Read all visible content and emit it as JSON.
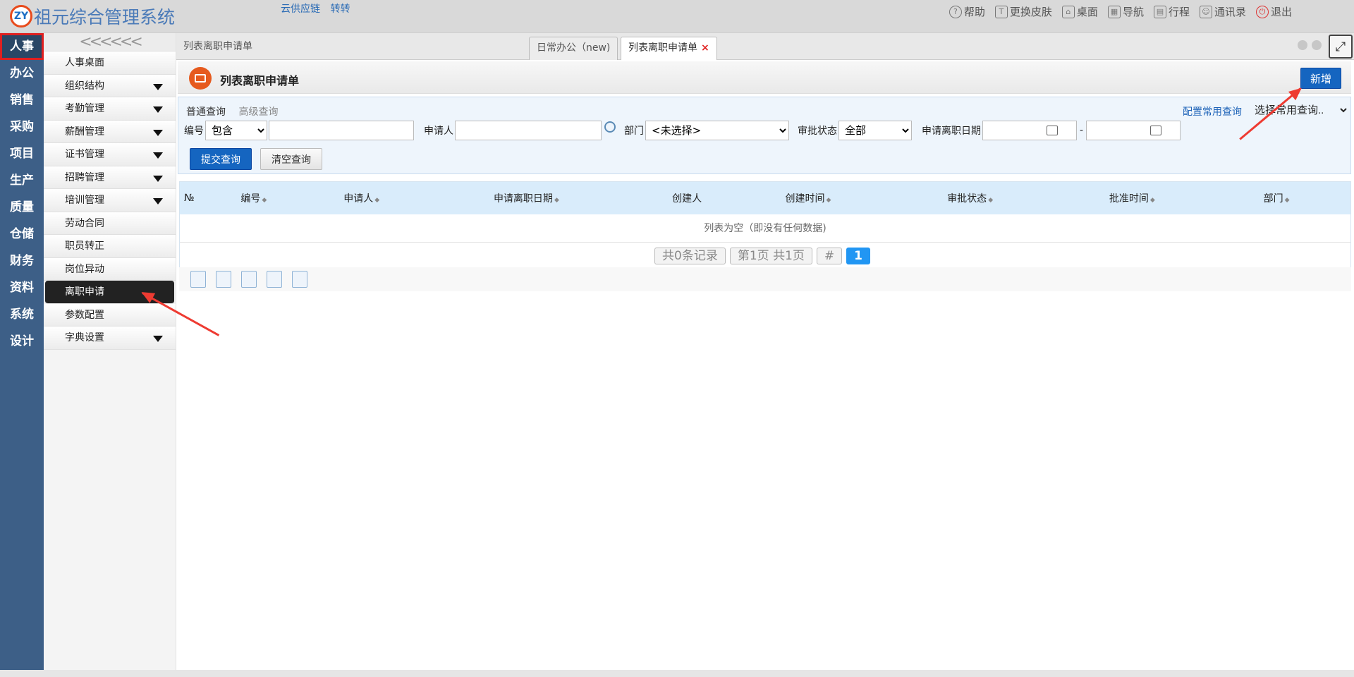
{
  "app": {
    "logo_mark": "ZY",
    "title": "祖元综合管理系统"
  },
  "top_links": [
    "云供应链",
    "转转"
  ],
  "top_right": [
    {
      "label": "帮助",
      "icon": "help-icon"
    },
    {
      "label": "更换皮肤",
      "icon": "shirt-icon"
    },
    {
      "label": "桌面",
      "icon": "home-icon"
    },
    {
      "label": "导航",
      "icon": "grid-icon"
    },
    {
      "label": "行程",
      "icon": "calendar-icon"
    },
    {
      "label": "通讯录",
      "icon": "contacts-icon"
    },
    {
      "label": "退出",
      "icon": "power-icon"
    }
  ],
  "left_nav": [
    "人事",
    "办公",
    "销售",
    "采购",
    "项目",
    "生产",
    "质量",
    "仓储",
    "财务",
    "资料",
    "系统",
    "设计"
  ],
  "submenu": [
    {
      "label": "人事桌面",
      "caret": false
    },
    {
      "label": "组织结构",
      "caret": true
    },
    {
      "label": "考勤管理",
      "caret": true
    },
    {
      "label": "薪酬管理",
      "caret": true
    },
    {
      "label": "证书管理",
      "caret": true
    },
    {
      "label": "招聘管理",
      "caret": true
    },
    {
      "label": "培训管理",
      "caret": true
    },
    {
      "label": "劳动合同",
      "caret": false
    },
    {
      "label": "职员转正",
      "caret": false
    },
    {
      "label": "岗位异动",
      "caret": false
    },
    {
      "label": "离职申请",
      "caret": false,
      "active": true
    },
    {
      "label": "参数配置",
      "caret": false
    },
    {
      "label": "字典设置",
      "caret": true
    }
  ],
  "breadcrumb": "列表离职申请单",
  "tabs": [
    {
      "label": "日常办公（new)"
    },
    {
      "label": "列表离职申请单",
      "close": "×"
    }
  ],
  "page": {
    "title": "列表离职申请单",
    "new_button": "新增"
  },
  "query": {
    "tab_normal": "普通查询",
    "tab_advanced": "高级查询",
    "config_link": "配置常用查询",
    "common_select": "选择常用查询..",
    "code_label": "编号",
    "code_op": "包含",
    "applicant_label": "申请人",
    "dept_label": "部门",
    "dept_value": "<未选择>",
    "status_label": "审批状态",
    "status_value": "全部",
    "date_label": "申请离职日期",
    "date_sep": "-",
    "submit": "提交查询",
    "clear": "清空查询"
  },
  "table": {
    "columns": [
      "№",
      "编号",
      "申请人",
      "申请离职日期",
      "创建人",
      "创建时间",
      "审批状态",
      "批准时间",
      "部门"
    ],
    "empty_text": "列表为空（即没有任何数据)"
  },
  "pager": {
    "records": "共0条记录",
    "pages": "第1页 共1页",
    "hash": "#",
    "current": "1"
  }
}
